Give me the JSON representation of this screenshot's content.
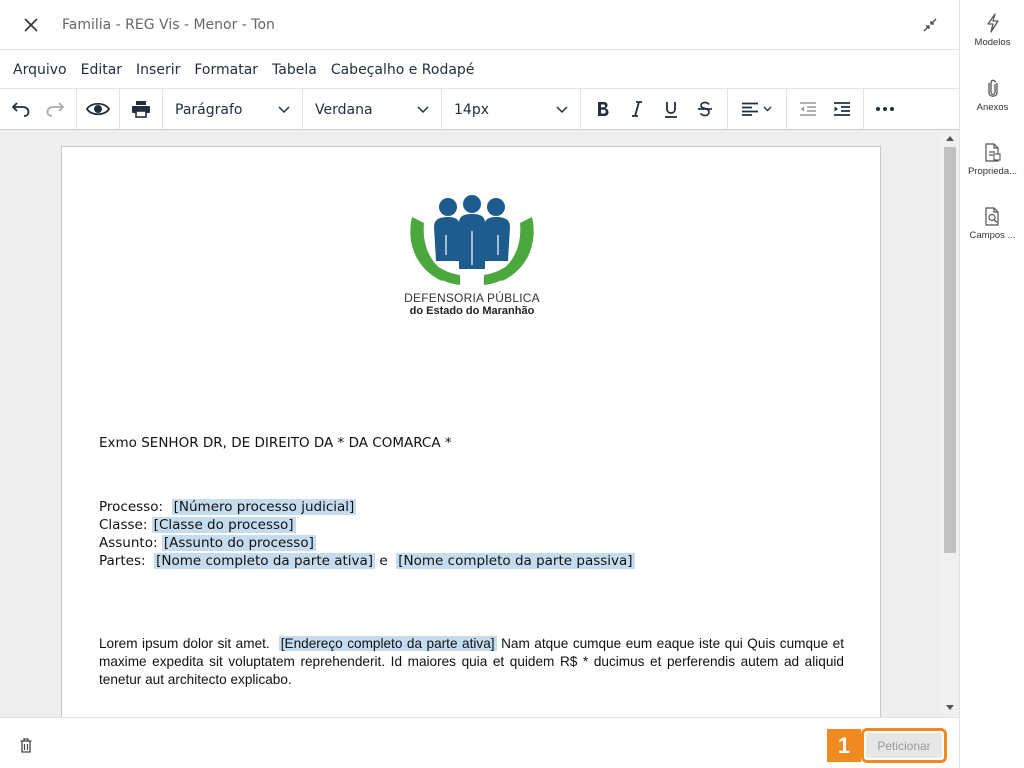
{
  "header": {
    "title": "Familia - REG Vis - Menor - Ton",
    "close_icon": "close-icon",
    "minimize_icon": "minimize-icon"
  },
  "menubar": {
    "items": [
      "Arquivo",
      "Editar",
      "Inserir",
      "Formatar",
      "Tabela",
      "Cabeçalho e Rodapé"
    ]
  },
  "toolbar": {
    "undo_icon": "undo-icon",
    "redo_icon": "redo-icon",
    "preview_icon": "eye-icon",
    "print_icon": "print-icon",
    "block_format": "Parágrafo",
    "font_family": "Verdana",
    "font_size": "14px",
    "bold_icon": "bold-icon",
    "italic_icon": "italic-icon",
    "underline_icon": "underline-icon",
    "strike_icon": "strikethrough-icon",
    "align_icon": "align-left-icon",
    "outdent_icon": "outdent-icon",
    "indent_icon": "indent-icon",
    "more_icon": "more-icon"
  },
  "document": {
    "logo_line1": "DEFENSORIA PÚBLICA",
    "logo_line2": "do Estado do Maranhão",
    "salutation": "Exmo SENHOR DR, DE DIREITO DA * DA COMARCA *",
    "processo_label": "Processo:",
    "processo_value": "[Número processo judicial]",
    "classe_label": "Classe:",
    "classe_value": "[Classe do processo]",
    "assunto_label": "Assunto:",
    "assunto_value": "[Assunto do processo]",
    "partes_label": "Partes:",
    "parte_ativa": "[Nome completo da parte ativa]",
    "partes_connector": "e",
    "parte_passiva": "[Nome completo da parte passiva]",
    "paragraph_start": "Lorem ipsum dolor sit amet.",
    "paragraph_field": "[Endereço completo da parte ativa]",
    "paragraph_rest": "Nam atque cumque eum eaque iste qui Quis cumque et maxime expedita sit voluptatem reprehenderit. Id maiores quia et quidem R$ * ducimus et perferendis autem ad aliquid tenetur aut architecto explicabo."
  },
  "footer": {
    "trash_icon": "trash-icon",
    "step_number": "1",
    "submit_label": "Peticionar"
  },
  "sidebar": {
    "items": [
      {
        "label": "Modelos",
        "icon": "lightning-icon"
      },
      {
        "label": "Anexos",
        "icon": "paperclip-icon"
      },
      {
        "label": "Proprieda...",
        "icon": "document-properties-icon"
      },
      {
        "label": "Campos ...",
        "icon": "document-search-icon"
      }
    ]
  },
  "colors": {
    "accent": "#ef8a20",
    "highlight": "#c5dcef",
    "logo_green": "#4aa83c",
    "logo_blue": "#1e5b8f"
  }
}
